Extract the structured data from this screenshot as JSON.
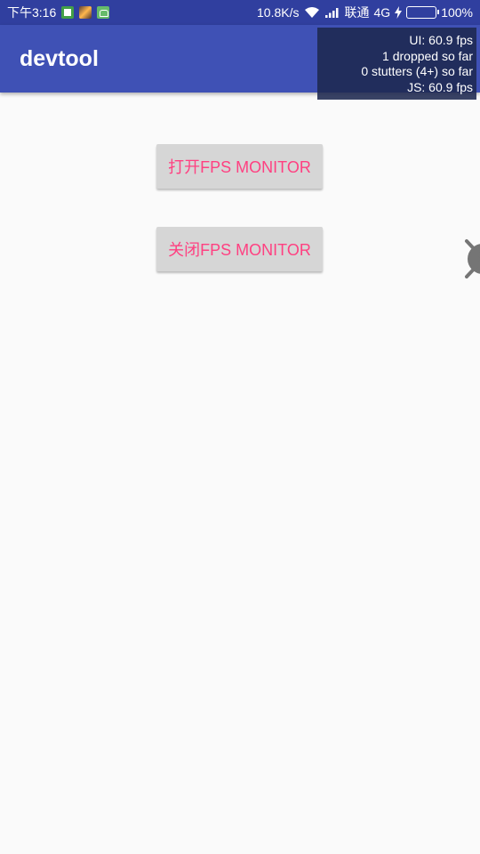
{
  "status_bar": {
    "time": "下午3:16",
    "speed": "10.8K/s",
    "carrier": "联通",
    "network": "4G",
    "battery": "100%",
    "notification_icons": [
      "sim-card-icon",
      "photo-icon",
      "android-icon"
    ]
  },
  "app_bar": {
    "title": "devtool"
  },
  "fps_monitor": {
    "ui_fps": "UI: 60.9 fps",
    "dropped": "1 dropped so far",
    "stutters": "0 stutters (4+) so far",
    "js_fps": "JS: 60.9 fps"
  },
  "buttons": {
    "open_label": "打开FPS MONITOR",
    "close_label": "关闭FPS MONITOR"
  },
  "colors": {
    "status_bar": "#303f9f",
    "app_bar": "#3f51b5",
    "button_text": "#ff4081",
    "button_bg": "#d6d6d6",
    "background": "#fafafa"
  }
}
